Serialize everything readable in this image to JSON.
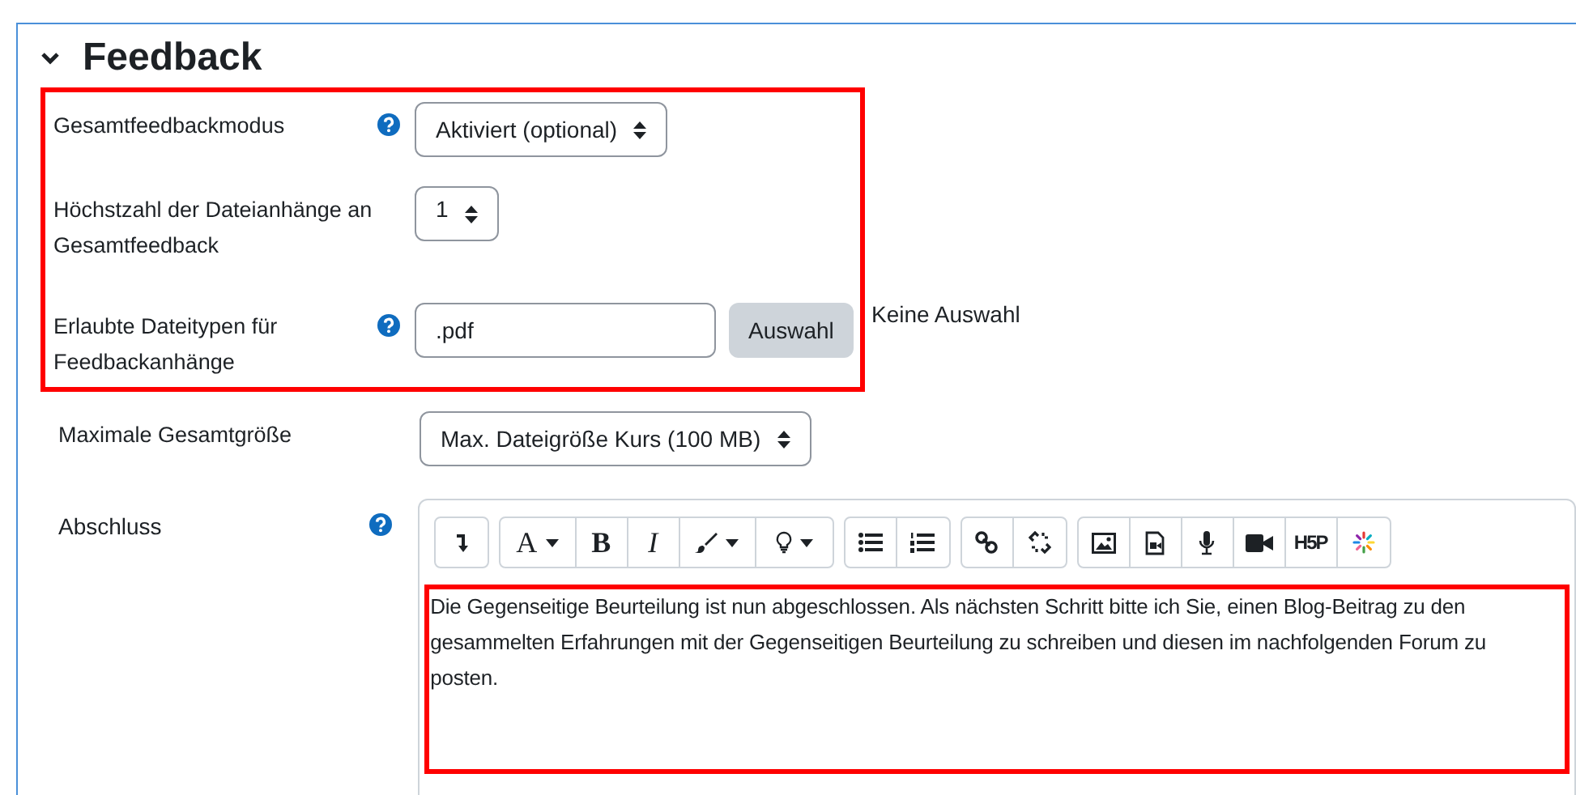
{
  "section": {
    "title": "Feedback",
    "expanded": true
  },
  "highlighted_fields": [
    {
      "kind": "select",
      "label": "Gesamtfeedbackmodus",
      "help": true,
      "value": "Aktiviert (optional)"
    },
    {
      "kind": "select",
      "label": "Höchstzahl der Dateianhänge an Gesamtfeedback",
      "help": false,
      "value": "1"
    },
    {
      "kind": "filetypes",
      "label": "Erlaubte Dateitypen für Feedbackanhänge",
      "help": true,
      "value": ".pdf",
      "button": "Auswahl",
      "note": "Keine Auswahl"
    }
  ],
  "fields": [
    {
      "kind": "select",
      "label": "Maximale Gesamtgröße",
      "help": false,
      "value": "Max. Dateigröße Kurs (100 MB)"
    }
  ],
  "editor": {
    "label": "Abschluss",
    "help": true,
    "toolbar": [
      [
        {
          "kind": "collapse"
        }
      ],
      [
        {
          "kind": "fontcolor",
          "label": "A"
        },
        {
          "kind": "bold",
          "label": "B"
        },
        {
          "kind": "italic",
          "label": "I"
        },
        {
          "kind": "brush"
        },
        {
          "kind": "bulb"
        }
      ],
      [
        {
          "kind": "bullets"
        },
        {
          "kind": "numbered"
        }
      ],
      [
        {
          "kind": "link"
        },
        {
          "kind": "unlink"
        }
      ],
      [
        {
          "kind": "image"
        },
        {
          "kind": "media"
        },
        {
          "kind": "mic"
        },
        {
          "kind": "video"
        },
        {
          "kind": "h5p",
          "label": "H5P"
        },
        {
          "kind": "sparkle"
        }
      ]
    ],
    "content": "Die Gegenseitige Beurteilung ist nun abgeschlossen. Als nächsten Schritt bitte ich Sie, einen Blog-Beitrag zu den gesammelten Erfahrungen mit der Gegenseitigen Beurteilung zu schreiben und diesen im nachfolgenden Forum zu posten."
  }
}
